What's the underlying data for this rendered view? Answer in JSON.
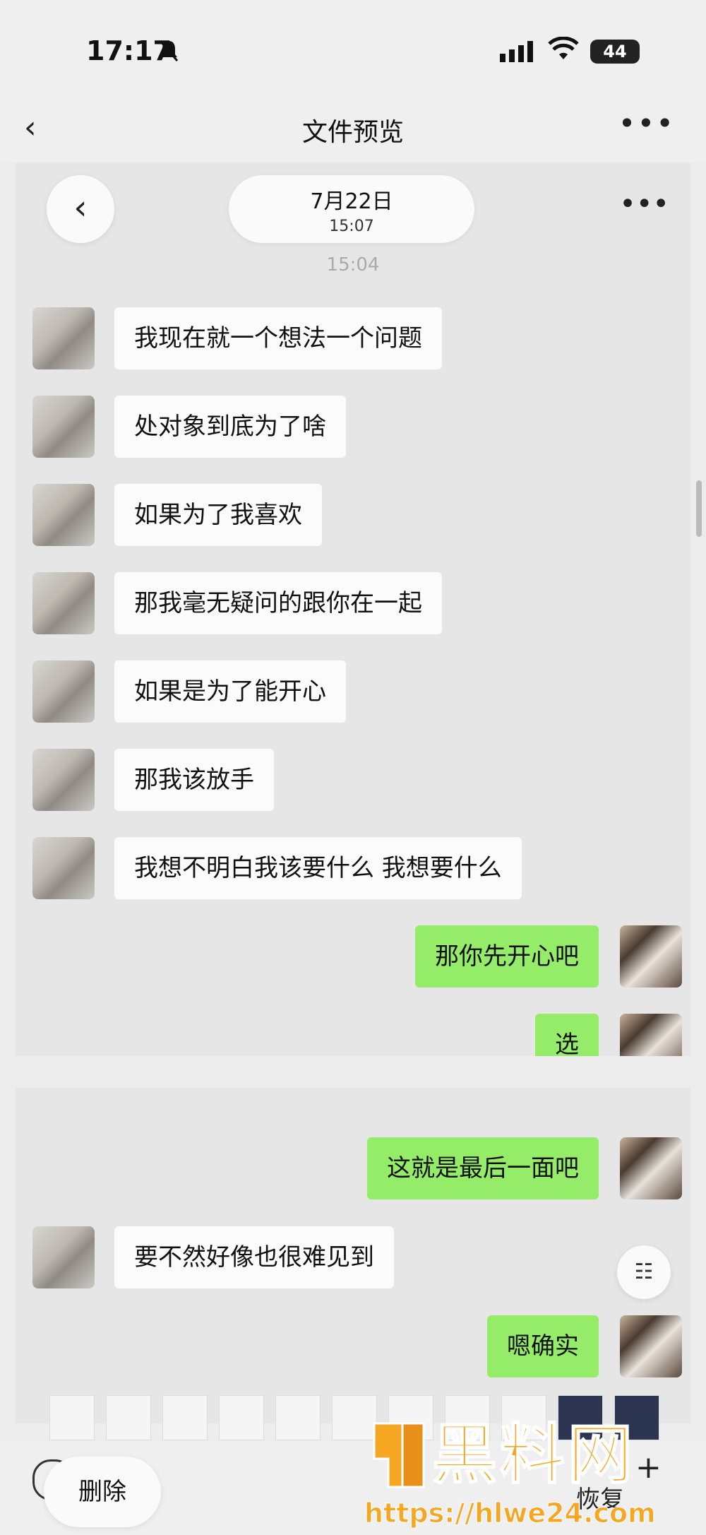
{
  "status_bar": {
    "time": "17:17",
    "battery": "44"
  },
  "nav": {
    "title": "文件预览"
  },
  "chat": {
    "date": "7月22日",
    "date_time": "15:07",
    "timestamp": "15:04",
    "messages_top": [
      "我现在就一个想法一个问题",
      "处对象到底为了啥",
      "如果为了我喜欢",
      "那我毫无疑问的跟你在一起",
      "如果是为了能开心",
      "那我该放手",
      "我想不明白我该要什么 我想要什么",
      "那你先开心吧",
      "选"
    ],
    "messages_bottom": [
      "这就是最后一面吧",
      "要不然好像也很难见到",
      "嗯确实"
    ]
  },
  "bottom_bar": {
    "delete_label": "删除",
    "restore_label": "恢复"
  },
  "watermark": {
    "brand": "黑料网",
    "url": "https://hlwe24.com"
  }
}
